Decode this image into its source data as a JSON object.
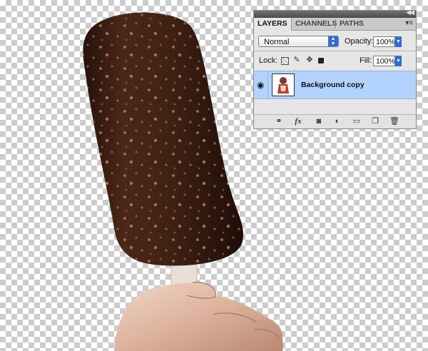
{
  "panel": {
    "tabs": [
      {
        "label": "LAYERS",
        "active": true
      },
      {
        "label": "CHANNELS",
        "active": false
      },
      {
        "label": "PATHS",
        "active": false
      }
    ],
    "blend_mode": "Normal",
    "opacity_label": "Opacity:",
    "opacity_value": "100%",
    "lock_label": "Lock:",
    "fill_label": "Fill:",
    "fill_value": "100%",
    "layers": [
      {
        "name": "Background copy",
        "visible": true,
        "selected": true
      }
    ],
    "icons": {
      "collapse": "collapse-icon",
      "menu": "panel-menu-icon",
      "lock": [
        "lock-transparent-pixels-icon",
        "lock-image-pixels-icon",
        "lock-position-icon",
        "lock-all-icon"
      ],
      "footer": [
        "link-layers-icon",
        "layer-style-fx-icon",
        "add-mask-icon",
        "adjustment-layer-icon",
        "new-group-icon",
        "new-layer-icon",
        "trash-icon"
      ]
    }
  },
  "colors": {
    "selection": "#b2d2ff",
    "accent": "#2f6fd4",
    "chocolate": "#3d2114",
    "panel_bg": "#e6e6e6"
  }
}
